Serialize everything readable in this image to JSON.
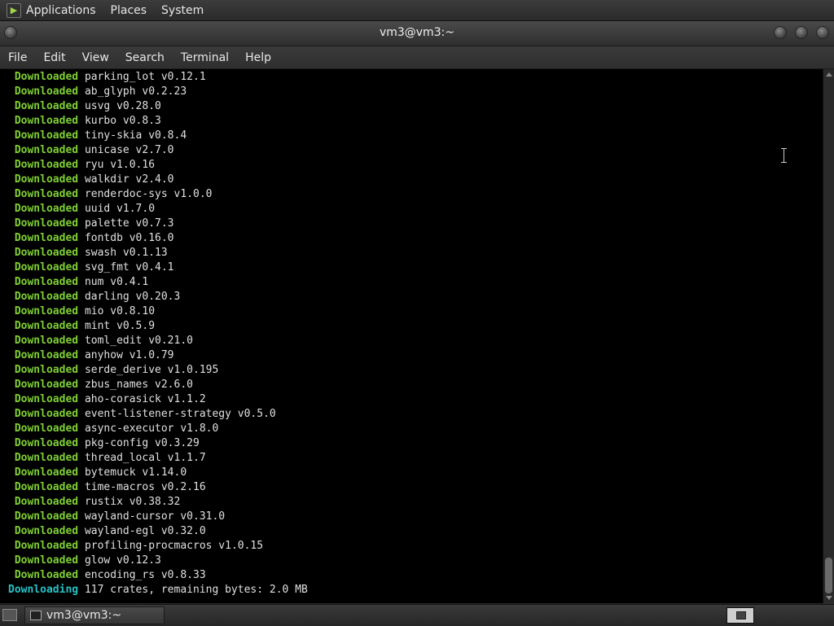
{
  "top_panel": {
    "menus": [
      "Applications",
      "Places",
      "System"
    ]
  },
  "window": {
    "title": "vm3@vm3:~",
    "menus": [
      "File",
      "Edit",
      "View",
      "Search",
      "Terminal",
      "Help"
    ]
  },
  "terminal": {
    "keyword_color": "#7fcf35",
    "status_color": "#27c2c8",
    "lines": [
      {
        "keyword": "Downloaded",
        "text": "parking_lot v0.12.1"
      },
      {
        "keyword": "Downloaded",
        "text": "ab_glyph v0.2.23"
      },
      {
        "keyword": "Downloaded",
        "text": "usvg v0.28.0"
      },
      {
        "keyword": "Downloaded",
        "text": "kurbo v0.8.3"
      },
      {
        "keyword": "Downloaded",
        "text": "tiny-skia v0.8.4"
      },
      {
        "keyword": "Downloaded",
        "text": "unicase v2.7.0"
      },
      {
        "keyword": "Downloaded",
        "text": "ryu v1.0.16"
      },
      {
        "keyword": "Downloaded",
        "text": "walkdir v2.4.0"
      },
      {
        "keyword": "Downloaded",
        "text": "renderdoc-sys v1.0.0"
      },
      {
        "keyword": "Downloaded",
        "text": "uuid v1.7.0"
      },
      {
        "keyword": "Downloaded",
        "text": "palette v0.7.3"
      },
      {
        "keyword": "Downloaded",
        "text": "fontdb v0.16.0"
      },
      {
        "keyword": "Downloaded",
        "text": "swash v0.1.13"
      },
      {
        "keyword": "Downloaded",
        "text": "svg_fmt v0.4.1"
      },
      {
        "keyword": "Downloaded",
        "text": "num v0.4.1"
      },
      {
        "keyword": "Downloaded",
        "text": "darling v0.20.3"
      },
      {
        "keyword": "Downloaded",
        "text": "mio v0.8.10"
      },
      {
        "keyword": "Downloaded",
        "text": "mint v0.5.9"
      },
      {
        "keyword": "Downloaded",
        "text": "toml_edit v0.21.0"
      },
      {
        "keyword": "Downloaded",
        "text": "anyhow v1.0.79"
      },
      {
        "keyword": "Downloaded",
        "text": "serde_derive v1.0.195"
      },
      {
        "keyword": "Downloaded",
        "text": "zbus_names v2.6.0"
      },
      {
        "keyword": "Downloaded",
        "text": "aho-corasick v1.1.2"
      },
      {
        "keyword": "Downloaded",
        "text": "event-listener-strategy v0.5.0"
      },
      {
        "keyword": "Downloaded",
        "text": "async-executor v1.8.0"
      },
      {
        "keyword": "Downloaded",
        "text": "pkg-config v0.3.29"
      },
      {
        "keyword": "Downloaded",
        "text": "thread_local v1.1.7"
      },
      {
        "keyword": "Downloaded",
        "text": "bytemuck v1.14.0"
      },
      {
        "keyword": "Downloaded",
        "text": "time-macros v0.2.16"
      },
      {
        "keyword": "Downloaded",
        "text": "rustix v0.38.32"
      },
      {
        "keyword": "Downloaded",
        "text": "wayland-cursor v0.31.0"
      },
      {
        "keyword": "Downloaded",
        "text": "wayland-egl v0.32.0"
      },
      {
        "keyword": "Downloaded",
        "text": "profiling-procmacros v1.0.15"
      },
      {
        "keyword": "Downloaded",
        "text": "glow v0.12.3"
      },
      {
        "keyword": "Downloaded",
        "text": "encoding_rs v0.8.33"
      }
    ],
    "status_line": {
      "keyword": "Downloading",
      "text": "117 crates, remaining bytes: 2.0 MB"
    }
  },
  "taskbar": {
    "task_label": "vm3@vm3:~"
  }
}
